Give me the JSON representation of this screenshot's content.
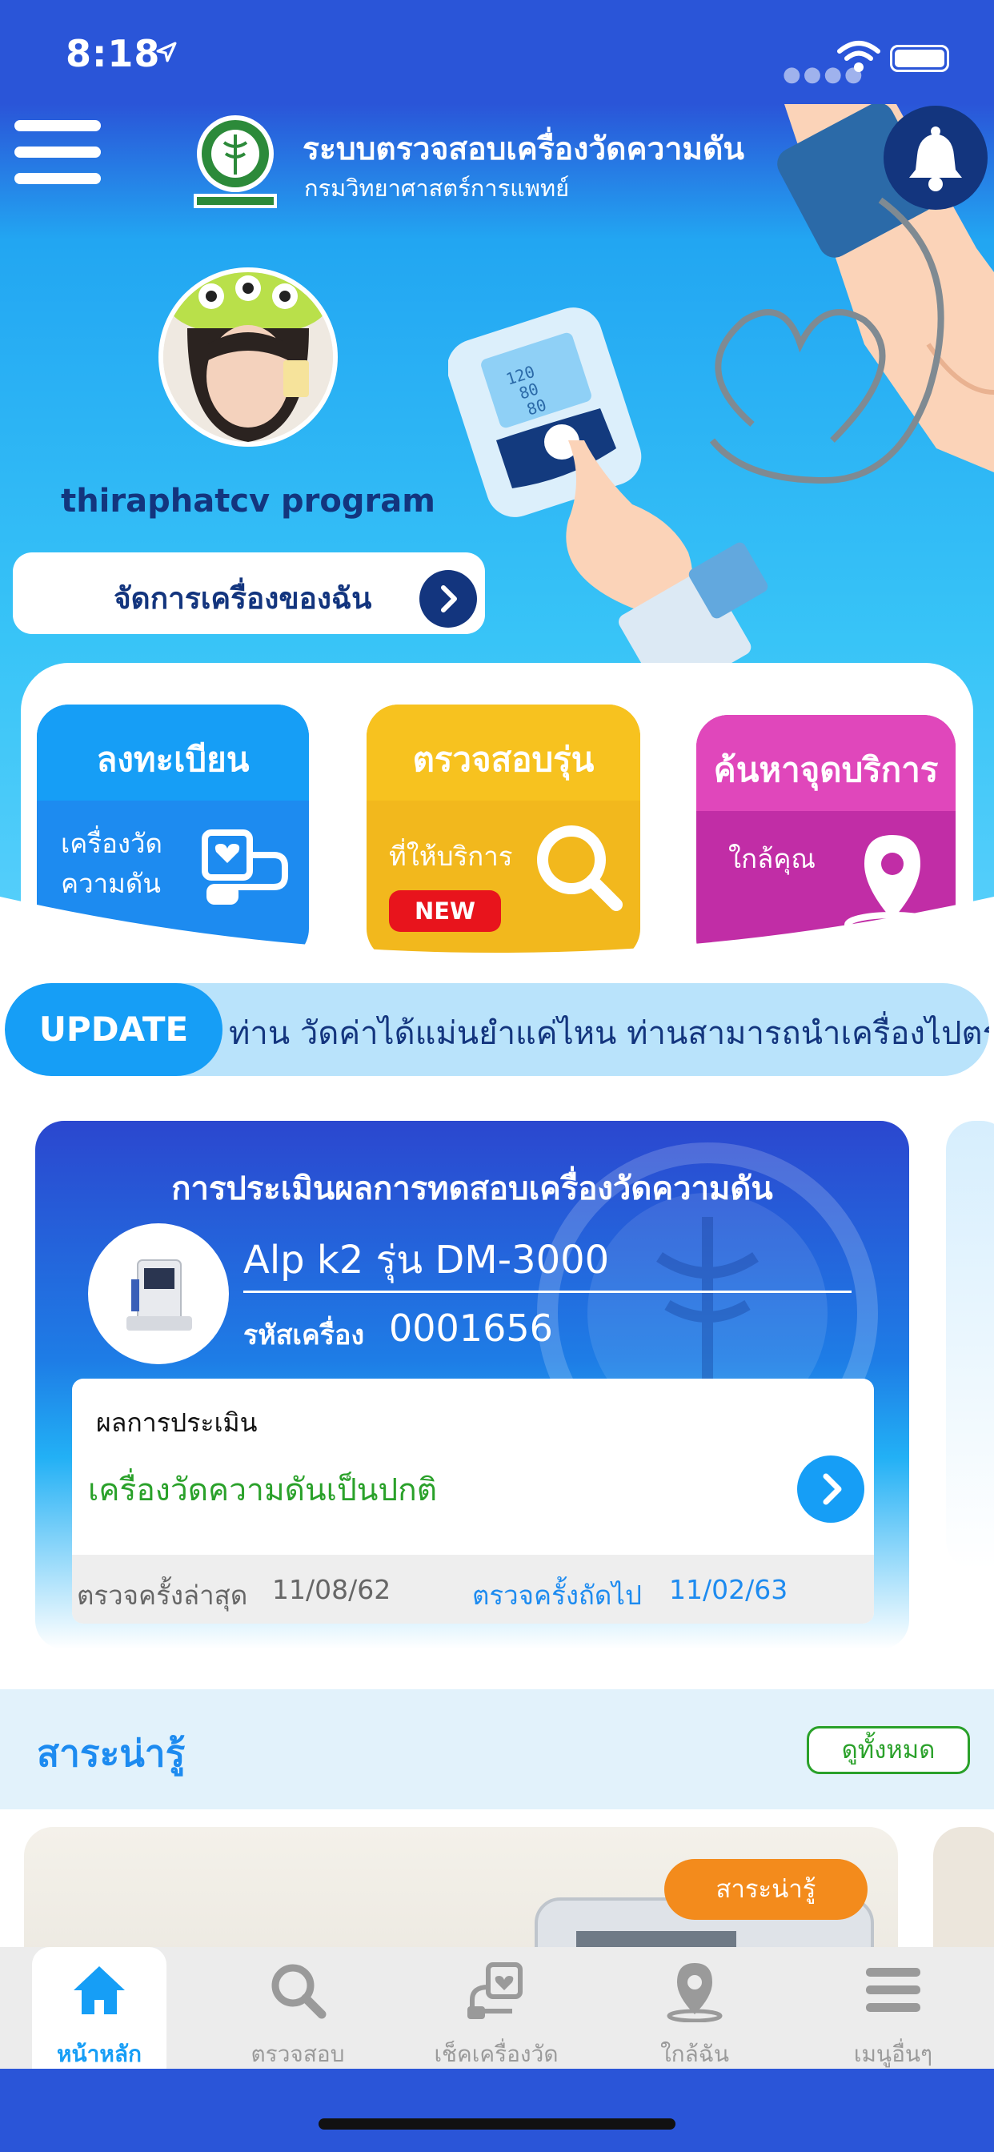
{
  "status_bar": {
    "time": "8:18"
  },
  "header": {
    "title": "ระบบตรวจสอบเครื่องวัดความดัน",
    "subtitle": "กรมวิทยาศาสตร์การแพทย์"
  },
  "profile": {
    "username": "thiraphatcv program",
    "manage_label": "จัดการเครื่องของฉัน"
  },
  "cards": {
    "register": {
      "title": "ลงทะเบียน",
      "sub1": "เครื่องวัด",
      "sub2": "ความดัน"
    },
    "model": {
      "title": "ตรวจสอบรุ่น",
      "sub1": "ที่ให้บริการ",
      "badge": "NEW"
    },
    "find": {
      "title": "ค้นหาจุดบริการ",
      "sub1": "ใกล้คุณ"
    }
  },
  "ticker": {
    "badge": "UPDATE",
    "text": "ท่าน วัดค่าได้แม่นยำแค่ไหน ท่านสามารถนำเครื่องไปตรว"
  },
  "evaluation": {
    "title": "การประเมินผลการทดสอบเครื่องวัดความดัน",
    "device_name": "Alp k2 รุ่น DM-3000",
    "code_label": "รหัสเครื่อง",
    "code": "0001656",
    "result_label": "ผลการประเมิน",
    "result_value": "เครื่องวัดความดันเป็นปกติ",
    "last_label": "ตรวจครั้งล่าสุด",
    "last_date": "11/08/62",
    "next_label": "ตรวจครั้งถัดไป",
    "next_date": "11/02/63"
  },
  "knowledge": {
    "title": "สาระน่ารู้",
    "see_all": "ดูทั้งหมด",
    "tag": "สาระน่ารู้"
  },
  "tabs": [
    {
      "label": "หน้าหลัก",
      "icon": "home-icon"
    },
    {
      "label": "ตรวจสอบ",
      "icon": "search-icon"
    },
    {
      "label": "เช็คเครื่องวัด",
      "icon": "bp-device-icon"
    },
    {
      "label": "ใกล้ฉัน",
      "icon": "location-pin-icon"
    },
    {
      "label": "เมนูอื่นๆ",
      "icon": "menu-icon"
    }
  ],
  "colors": {
    "primary_blue": "#2a55d8",
    "navy": "#13357e",
    "sky": "#169ef6",
    "yellow": "#f7c21f",
    "magenta": "#e047bb",
    "green": "#2aa12a",
    "orange": "#f38b1c",
    "new_red": "#e8141c"
  }
}
